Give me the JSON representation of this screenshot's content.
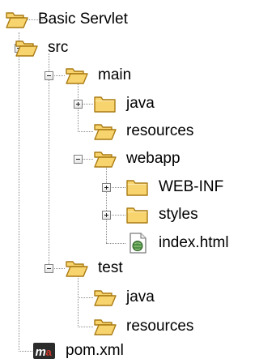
{
  "tree": {
    "nodes": [
      {
        "label": "Basic Servlet",
        "icon": "folder-open-icon",
        "state": "expanded"
      },
      {
        "label": "src",
        "icon": "folder-open-icon",
        "state": "expanded"
      },
      {
        "label": "main",
        "icon": "folder-open-icon",
        "state": "expanded"
      },
      {
        "label": "java",
        "icon": "folder-closed-icon",
        "state": "collapsed"
      },
      {
        "label": "resources",
        "icon": "folder-open-icon",
        "state": "leaf"
      },
      {
        "label": "webapp",
        "icon": "folder-open-icon",
        "state": "expanded"
      },
      {
        "label": "WEB-INF",
        "icon": "folder-closed-icon",
        "state": "collapsed"
      },
      {
        "label": "styles",
        "icon": "folder-closed-icon",
        "state": "collapsed"
      },
      {
        "label": "index.html",
        "icon": "html-file-icon",
        "state": "leaf"
      },
      {
        "label": "test",
        "icon": "folder-open-icon",
        "state": "expanded"
      },
      {
        "label": "java",
        "icon": "folder-open-icon",
        "state": "leaf"
      },
      {
        "label": "resources",
        "icon": "folder-open-icon",
        "state": "leaf"
      },
      {
        "label": "pom.xml",
        "icon": "maven-file-icon",
        "state": "leaf"
      }
    ]
  },
  "colors": {
    "folder_fill": "#f8d46f",
    "folder_stroke": "#a97a12",
    "guide_line": "#8a8a8a",
    "expander_border": "#7f7f7f",
    "maven_red": "#d23a2a"
  }
}
